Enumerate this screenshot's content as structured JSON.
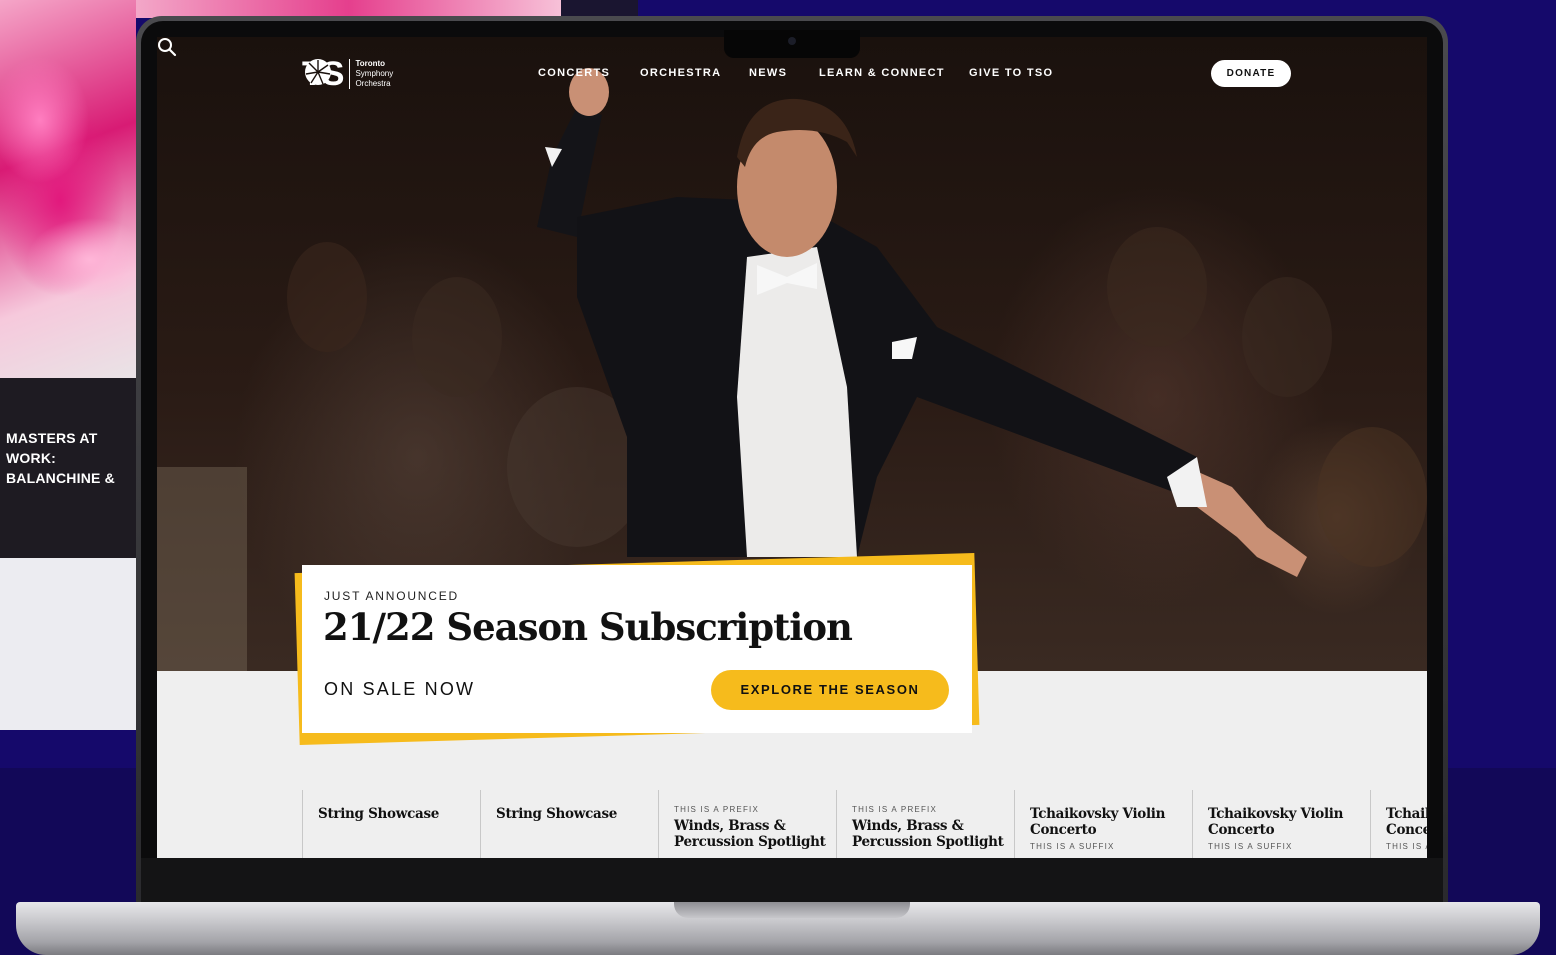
{
  "background": {
    "side_card_title": "MASTERS AT WORK: BALANCHINE &"
  },
  "logo": {
    "initials": "TS",
    "line1": "Toronto",
    "line2": "Symphony",
    "line3": "Orchestra",
    "icon": "orchestra-burst-icon"
  },
  "nav": {
    "items": [
      {
        "label": "CONCERTS"
      },
      {
        "label": "ORCHESTRA"
      },
      {
        "label": "NEWS"
      },
      {
        "label": "LEARN & CONNECT"
      },
      {
        "label": "GIVE TO TSO"
      }
    ],
    "search_icon": "search-icon",
    "donate_label": "DONATE"
  },
  "promo": {
    "eyebrow": "JUST ANNOUNCED",
    "title": "21/22 Season Subscription",
    "subtitle": "ON SALE NOW",
    "cta_label": "EXPLORE THE SEASON"
  },
  "concerts": [
    {
      "prefix": "",
      "title": "String Showcase",
      "suffix": ""
    },
    {
      "prefix": "",
      "title": "String Showcase",
      "suffix": ""
    },
    {
      "prefix": "THIS IS A PREFIX",
      "title": "Winds, Brass & Percussion Spotlight",
      "suffix": ""
    },
    {
      "prefix": "THIS IS A PREFIX",
      "title": "Winds, Brass & Percussion Spotlight",
      "suffix": ""
    },
    {
      "prefix": "",
      "title": "Tchaikovsky Violin Concerto",
      "suffix": "THIS IS A SUFFIX"
    },
    {
      "prefix": "",
      "title": "Tchaikovsky Violin Concerto",
      "suffix": "THIS IS A SUFFIX"
    },
    {
      "prefix": "",
      "title": "Tchaikovsky Violin Concerto",
      "suffix": "THIS IS A SUFFIX"
    }
  ],
  "colors": {
    "accent_yellow": "#f6bb1c",
    "backdrop_navy": "#15096b",
    "hero_dark": "#1a110d"
  }
}
